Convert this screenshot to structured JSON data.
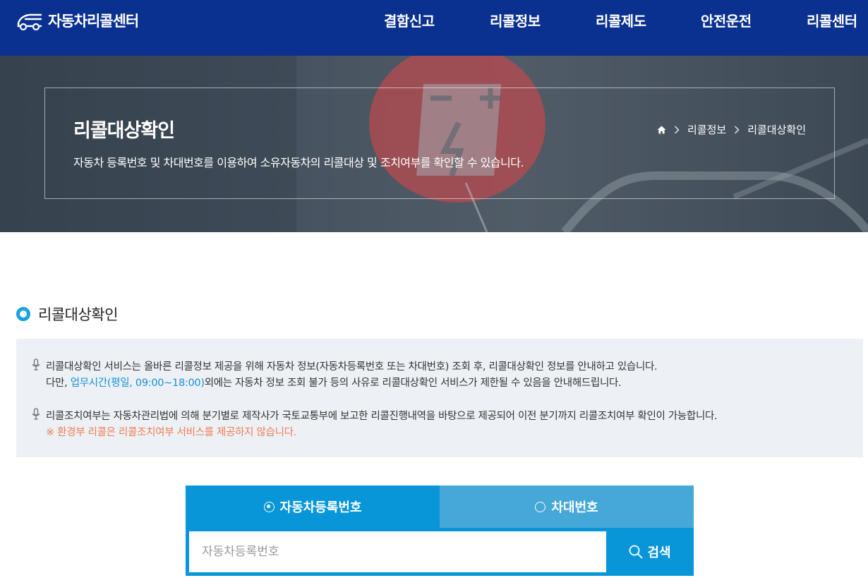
{
  "header": {
    "logo_text": "자동차리콜센터",
    "nav": [
      "결함신고",
      "리콜정보",
      "리콜제도",
      "안전운전",
      "리콜센터"
    ]
  },
  "hero": {
    "title": "리콜대상확인",
    "description": "자동차 등록번호 및 차대번호를 이용하여 소유자동차의 리콜대상 및 조치여부를 확인할 수 있습니다.",
    "breadcrumb": [
      "리콜정보",
      "리콜대상확인"
    ],
    "icons": {
      "home": "home-icon",
      "separator": "chevron-right-icon"
    }
  },
  "section": {
    "title": "리콜대상확인"
  },
  "notice": {
    "item1_line1": "리콜대상확인 서비스는 올바른 리콜정보 제공을 위해 자동차 정보(자동차등록번호 또는 차대번호) 조회 후, 리콜대상확인 정보를 안내하고 있습니다.",
    "item1_line2_prefix": "다만, ",
    "item1_line2_link": "업무시간(평일, 09:00~18:00)",
    "item1_line2_suffix": "외에는 자동차 정보 조회 불가 등의 사유로 리콜대상확인 서비스가 제한될 수 있음을 안내해드립니다.",
    "item2_line1": "리콜조치여부는 자동차관리법에 의해 분기별로 제작사가 국토교통부에 보고한 리콜진행내역을 바탕으로 제공되어 이전 분기까지 리콜조치여부 확인이 가능합니다.",
    "item2_warning": "※ 환경부 리콜은 리콜조치여부 서비스를 제공하지 않습니다."
  },
  "search": {
    "tabs": [
      {
        "label": "자동차등록번호",
        "selected": true
      },
      {
        "label": "차대번호",
        "selected": false
      }
    ],
    "input_value": "",
    "input_placeholder": "자동차등록번호",
    "button_label": "검색"
  },
  "colors": {
    "header_bg": "#0b3190",
    "tab_active": "#0896d9",
    "tab_inactive": "#45a8d6",
    "link": "#1a8fd8",
    "warning": "#ef7b52",
    "notice_bg": "#edf1f5",
    "section_dot": "#1aa2e2"
  }
}
